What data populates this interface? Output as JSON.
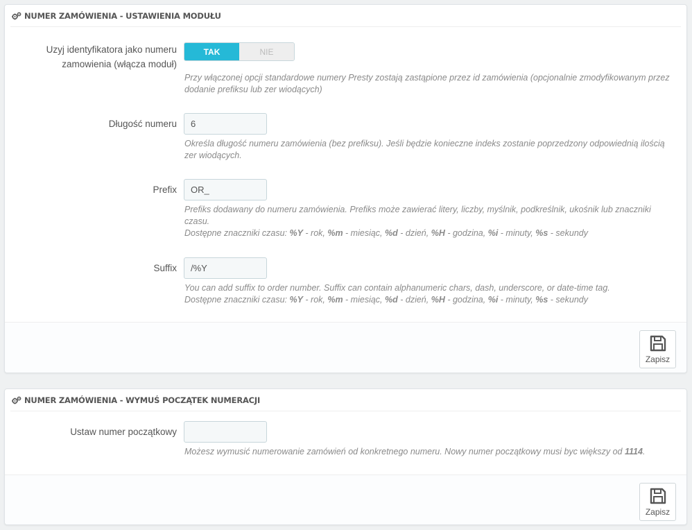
{
  "panel1": {
    "title": "NUMER ZAMÓWIENIA - USTAWIENIA MODUŁU",
    "title_icon": "cogs-icon",
    "use_id": {
      "label_line1": "Uzyj identyfikatora jako numeru",
      "label_line2": "zamowienia (włącza moduł)",
      "on_label": "TAK",
      "off_label": "NIE",
      "selected": "TAK",
      "help_line1": "Przy włączonej opcji standardowe numery Presty zostają zastąpione przez id zamówienia (opcjonalnie zmodyfikowanym przez",
      "help_line2": "dodanie prefiksu lub zer wiodących)"
    },
    "length": {
      "label": "Długość numeru",
      "value": "6",
      "help_line1": "Określa długość numeru zamówienia (bez prefiksu). Jeśli będzie konieczne indeks zostanie poprzedzony odpowiednią ilością",
      "help_line2": "zer wiodących."
    },
    "prefix": {
      "label": "Prefix",
      "value": "OR_",
      "help_line1": "Prefiks dodawany do numeru zamówienia. Prefiks może zawierać litery, liczby, myślnik, podkreślnik, ukośnik lub znaczniki",
      "help_line2": "czasu."
    },
    "suffix": {
      "label": "Suffix",
      "value": "/%Y",
      "help_line1": "You can add suffix to order number. Suffix can contain alphanumeric chars, dash, underscore, or date-time tag."
    },
    "tags": {
      "intro": "Dostępne znaczniki czasu: ",
      "y_tag": "%Y",
      "y_desc": " - rok, ",
      "m_tag": "%m",
      "m_desc": " - miesiąc, ",
      "d_tag": "%d",
      "d_desc": " - dzień, ",
      "h_tag": "%H",
      "h_desc": " - godzina, ",
      "i_tag": "%i",
      "i_desc": " - minuty, ",
      "s_tag": "%s",
      "s_desc": " - sekundy"
    },
    "save_label": "Zapisz"
  },
  "panel2": {
    "title": "NUMER ZAMÓWIENIA - WYMUŚ POCZĄTEK NUMERACJI",
    "title_icon": "cogs-icon",
    "start": {
      "label": "Ustaw numer początkowy",
      "value": "",
      "help_text": "Możesz wymusić numerowanie zamówień od konkretnego numeru. Nowy numer początkowy musi byc większy od ",
      "help_number": "1114",
      "help_end": "."
    },
    "save_label": "Zapisz"
  },
  "colors": {
    "accent": "#25b9d7",
    "help_text": "#8a8a8a",
    "input_bg": "#f5f8f9",
    "page_bg": "#eff1f2"
  }
}
